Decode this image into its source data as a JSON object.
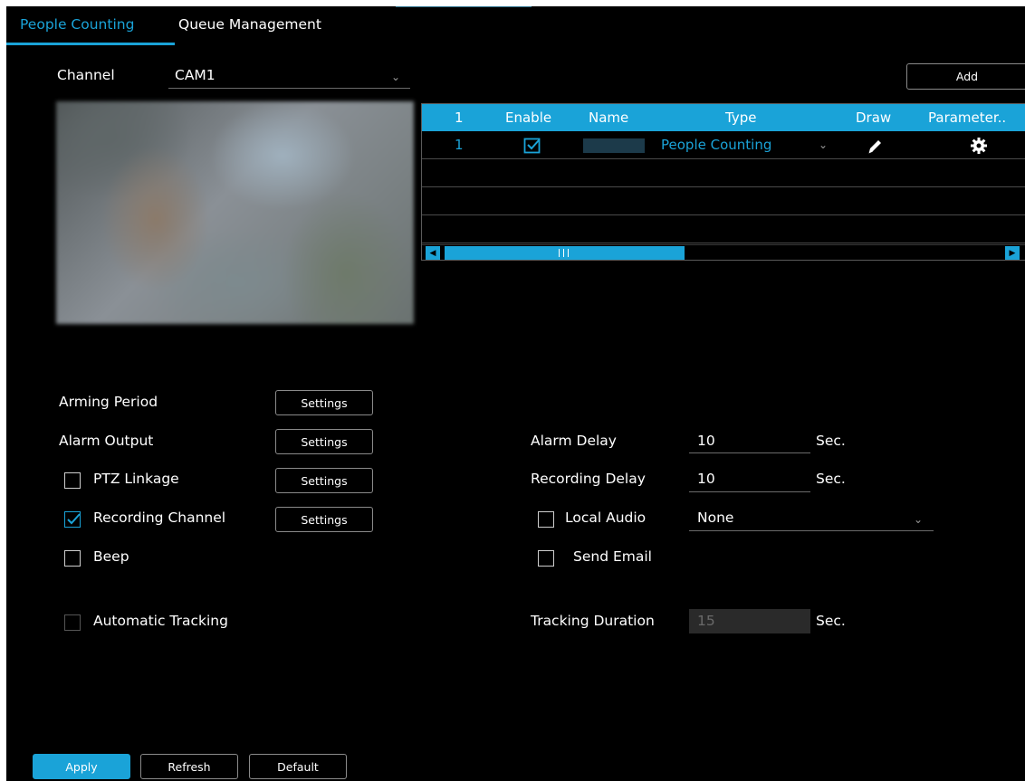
{
  "tabs": [
    {
      "label": "People Counting",
      "active": true
    },
    {
      "label": "Queue Management",
      "active": false
    }
  ],
  "channel": {
    "label": "Channel",
    "value": "CAM1"
  },
  "add_button": "Add",
  "table": {
    "headers": [
      "1",
      "Enable",
      "Name",
      "Type",
      "Draw",
      "Parameter.."
    ],
    "rows": [
      {
        "index": "1",
        "enabled": true,
        "name": "",
        "type": "People Counting"
      }
    ]
  },
  "left_settings": {
    "arming_period": "Arming Period",
    "alarm_output": "Alarm Output",
    "ptz_linkage": "PTZ Linkage",
    "recording_channel": "Recording Channel",
    "beep": "Beep",
    "automatic_tracking": "Automatic Tracking",
    "settings_label": "Settings"
  },
  "checks": {
    "ptz_linkage": false,
    "recording_channel": true,
    "beep": false,
    "automatic_tracking": false,
    "local_audio": false,
    "send_email": false
  },
  "right_settings": {
    "alarm_delay": {
      "label": "Alarm Delay",
      "value": "10",
      "unit": "Sec."
    },
    "recording_delay": {
      "label": "Recording Delay",
      "value": "10",
      "unit": "Sec."
    },
    "local_audio": {
      "label": "Local Audio",
      "value": "None"
    },
    "send_email": {
      "label": "Send Email"
    },
    "tracking_duration": {
      "label": "Tracking Duration",
      "value": "15",
      "unit": "Sec."
    }
  },
  "footer": {
    "apply": "Apply",
    "refresh": "Refresh",
    "default": "Default"
  },
  "colors": {
    "accent": "#1aa3d8",
    "background": "#000000"
  }
}
